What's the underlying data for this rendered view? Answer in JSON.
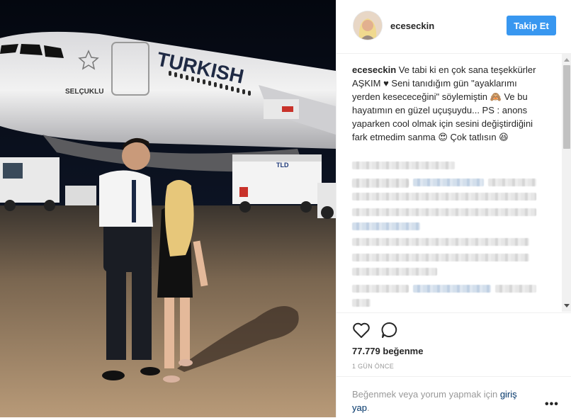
{
  "post": {
    "username": "eceseckin",
    "follow_label": "Takip Et",
    "caption_user": "eceseckin",
    "caption_text": "Ve tabi ki en çok sana teşekkürler AŞKIM ♥ Seni tanıdığım gün \"ayaklarımı yerden kesececeğini\" söylemiştin 🙈 Ve bu hayatımın en güzel uçuşuydu... PS : anons yaparken cool olmak için sesini değiştirdiğini fark etmedim sanma 😍 Çok tatlısın 😆",
    "likes": "77.779 beğenme",
    "time_ago": "1 GÜN ÖNCE",
    "login_prompt": "Beğenmek veya yorum yapmak için ",
    "login_link": "giriş yap",
    "login_suffix": ".",
    "more_label": "•••"
  },
  "photo": {
    "aircraft_name": "SELÇUKLU",
    "airline_text": "TURKISH",
    "truck_logo": "TLD"
  },
  "icons": {
    "like": "heart-outline-icon",
    "comment": "comment-bubble-icon",
    "more": "ellipsis-icon"
  },
  "colors": {
    "accent": "#3897f0",
    "link": "#003569",
    "muted": "#999999"
  }
}
